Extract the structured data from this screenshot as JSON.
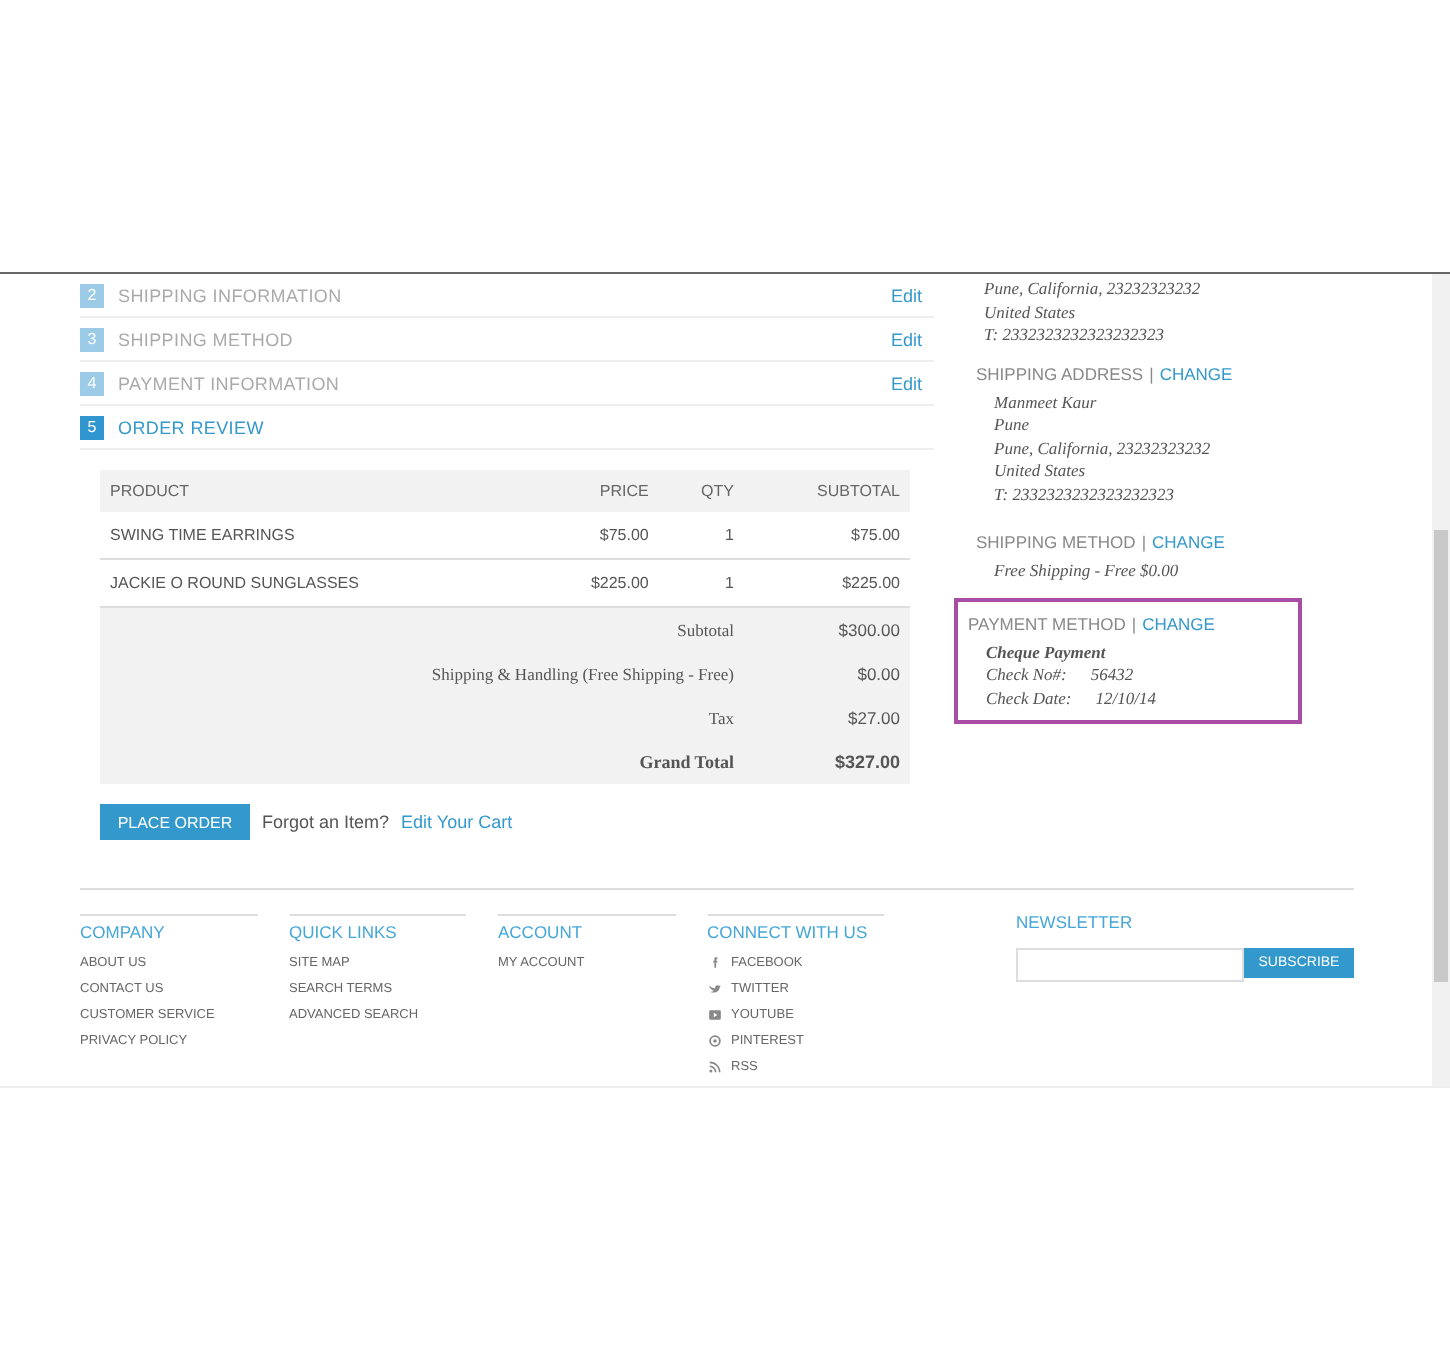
{
  "steps": [
    {
      "number": "2",
      "label": "SHIPPING INFORMATION",
      "action": "Edit",
      "selected": false
    },
    {
      "number": "3",
      "label": "SHIPPING METHOD",
      "action": "Edit",
      "selected": false
    },
    {
      "number": "4",
      "label": "PAYMENT INFORMATION",
      "action": "Edit",
      "selected": false
    },
    {
      "number": "5",
      "label": "ORDER REVIEW",
      "selected": true
    }
  ],
  "review": {
    "columns": [
      "PRODUCT",
      "PRICE",
      "QTY",
      "SUBTOTAL"
    ],
    "rows": [
      [
        "SWING TIME EARRINGS",
        "$75.00",
        "1",
        "$75.00"
      ],
      [
        "JACKIE O ROUND SUNGLASSES",
        "$225.00",
        "1",
        "$225.00"
      ]
    ],
    "totals": [
      {
        "label": "Subtotal",
        "value": "$300.00",
        "kind": "normal"
      },
      {
        "label": "Shipping & Handling (Free Shipping - Free)",
        "value": "$0.00",
        "kind": "normal"
      },
      {
        "label": "Tax",
        "value": "$27.00",
        "kind": "normal"
      },
      {
        "label": "Grand Total",
        "value": "$327.00",
        "kind": "grand"
      }
    ],
    "place_order": "PLACE ORDER",
    "forgot_text": "Forgot an Item?",
    "edit_cart_link": "Edit Your Cart"
  },
  "sidebar": {
    "address_tail": [
      "Pune, California, 23232323232",
      "United States",
      "T: 2332323232323232323"
    ],
    "sections": [
      {
        "heading": "SHIPPING ADDRESS",
        "separator": "|",
        "action": "CHANGE",
        "highlighted": false,
        "lines": [
          {
            "kind": "line",
            "text": "Manmeet Kaur"
          },
          {
            "kind": "line",
            "text": "Pune"
          },
          {
            "kind": "line",
            "text": "Pune, California, 23232323232"
          },
          {
            "kind": "line",
            "text": "United States"
          },
          {
            "kind": "line",
            "text": "T: 2332323232323232323"
          }
        ]
      },
      {
        "heading": "SHIPPING METHOD",
        "separator": "|",
        "action": "CHANGE",
        "highlighted": false,
        "lines": [
          {
            "kind": "line",
            "text": "Free Shipping - Free $0.00"
          }
        ]
      },
      {
        "heading": "PAYMENT METHOD",
        "separator": "|",
        "action": "CHANGE",
        "highlighted": true,
        "lines": [
          {
            "kind": "title",
            "text": "Cheque Payment"
          },
          {
            "kind": "pair",
            "label": "Check No#:",
            "value": "56432"
          },
          {
            "kind": "pair",
            "label": "Check Date:",
            "value": "12/10/14"
          }
        ]
      }
    ]
  },
  "footer": {
    "columns": [
      {
        "heading": "COMPANY",
        "links": [
          {
            "text": "ABOUT US"
          },
          {
            "text": "CONTACT US"
          },
          {
            "text": "CUSTOMER SERVICE"
          },
          {
            "text": "PRIVACY POLICY"
          }
        ]
      },
      {
        "heading": "QUICK LINKS",
        "links": [
          {
            "text": "SITE MAP"
          },
          {
            "text": "SEARCH TERMS"
          },
          {
            "text": "ADVANCED SEARCH"
          }
        ]
      },
      {
        "heading": "ACCOUNT",
        "links": [
          {
            "text": "MY ACCOUNT"
          }
        ]
      },
      {
        "heading": "CONNECT WITH US",
        "kind": "social",
        "links": [
          {
            "text": "FACEBOOK"
          },
          {
            "text": "TWITTER"
          },
          {
            "text": "YOUTUBE"
          },
          {
            "text": "PINTEREST"
          },
          {
            "text": "RSS"
          }
        ]
      }
    ],
    "newsletter": {
      "heading": "NEWSLETTER",
      "button": "SUBSCRIBE"
    }
  }
}
